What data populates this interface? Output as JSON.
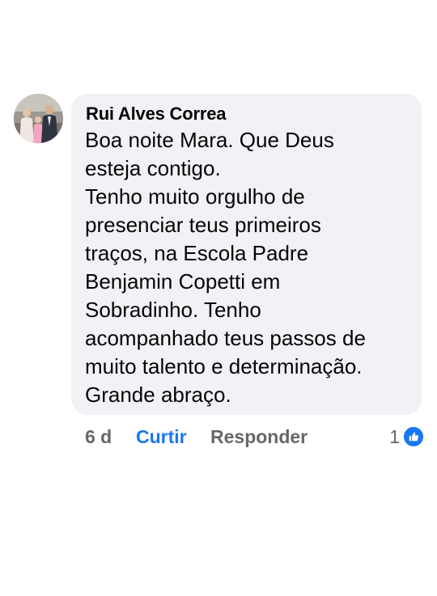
{
  "comment": {
    "author": "Rui Alves Correa",
    "text": "Boa noite Mara. Que Deus\nesteja contigo.\nTenho muito orgulho de\npresenciar teus primeiros\ntraços, na Escola Padre\nBenjamin Copetti em\nSobradinho.  Tenho\nacompanhado teus passos de\nmuito talento e determinação.\nGrande abraço.",
    "avatar_icon": "profile-photo"
  },
  "actions": {
    "time": "6 d",
    "like_label": "Curtir",
    "reply_label": "Responder",
    "reaction_count": "1",
    "reaction_icon": "like-thumb-icon"
  },
  "colors": {
    "bubble": "#f0f2f5",
    "like_active": "#1877f2",
    "muted": "#65676b",
    "text": "#050505"
  }
}
